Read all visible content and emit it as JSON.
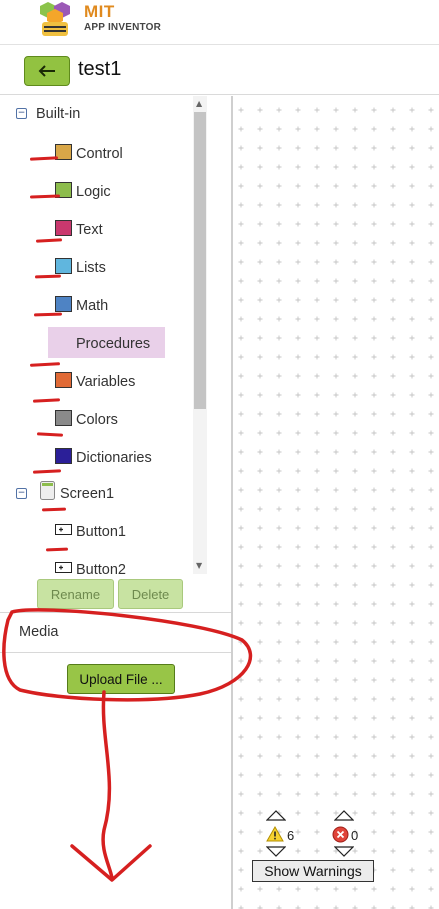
{
  "header": {
    "logo_title": "MIT",
    "logo_subtitle": "APP INVENTOR"
  },
  "project": {
    "title": "test1",
    "back_icon": "arrow-left-icon"
  },
  "tree": {
    "builtin_label": "Built-in",
    "categories": [
      {
        "label": "Control",
        "color": "#d9a748"
      },
      {
        "label": "Logic",
        "color": "#8dbd4d"
      },
      {
        "label": "Text",
        "color": "#c9386e"
      },
      {
        "label": "Lists",
        "color": "#60b6de"
      },
      {
        "label": "Math",
        "color": "#4e83c4"
      },
      {
        "label": "Procedures",
        "color": "#8a68a8"
      },
      {
        "label": "Variables",
        "color": "#e06a36"
      },
      {
        "label": "Colors",
        "color": "#8a8a8a"
      },
      {
        "label": "Dictionaries",
        "color": "#2b1f98"
      }
    ],
    "screen_label": "Screen1",
    "components": [
      {
        "label": "Button1"
      },
      {
        "label": "Button2"
      }
    ],
    "selected": "Procedures"
  },
  "buttons": {
    "rename": "Rename",
    "delete": "Delete",
    "upload": "Upload File ..."
  },
  "media": {
    "label": "Media"
  },
  "warnings": {
    "warning_count": "6",
    "error_count": "0",
    "show_label": "Show Warnings"
  },
  "colors": {
    "accent_green": "#92c241",
    "annotation_red": "#d62020"
  }
}
